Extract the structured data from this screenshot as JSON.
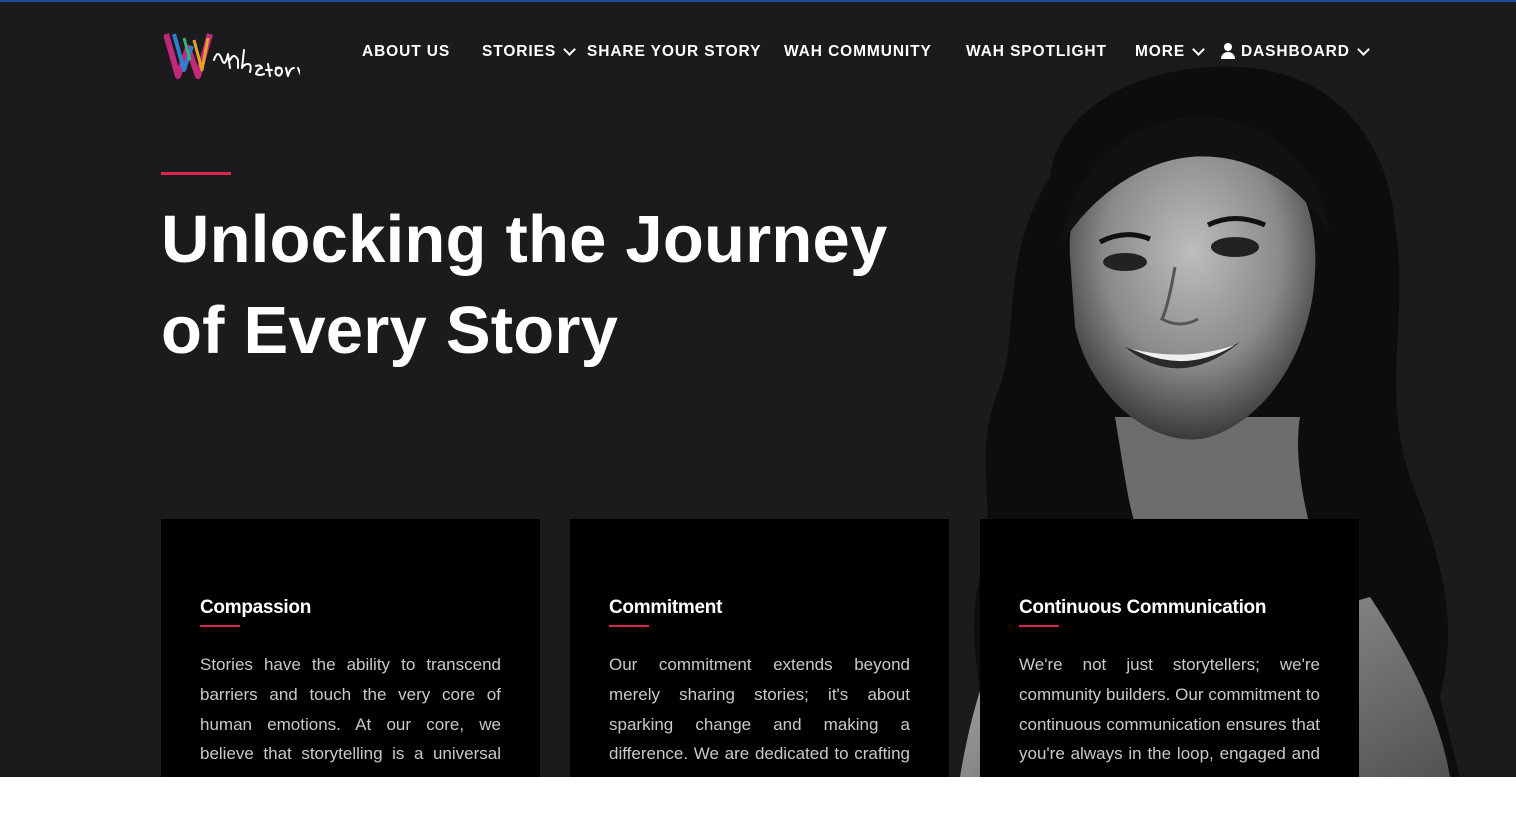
{
  "brand": {
    "logo_alt": "Wahstory"
  },
  "nav": {
    "items": [
      {
        "label": "ABOUT US",
        "has_dropdown": false
      },
      {
        "label": "STORIES",
        "has_dropdown": true
      },
      {
        "label": "SHARE YOUR STORY",
        "has_dropdown": false
      },
      {
        "label": "WAH COMMUNITY",
        "has_dropdown": false
      },
      {
        "label": "WAH SPOTLIGHT",
        "has_dropdown": false
      },
      {
        "label": "MORE",
        "has_dropdown": true
      },
      {
        "label": "DASHBOARD",
        "has_dropdown": true,
        "icon": "user-icon"
      }
    ]
  },
  "hero": {
    "headline_line1": "Unlocking the Journey",
    "headline_line2": "of Every Story",
    "accent_color": "#d8264f"
  },
  "cards": [
    {
      "title": "Compassion",
      "text": "Stories have the ability to transcend barriers and touch the very core of human emotions. At our core, we believe that storytelling is a universal language that unites us all. Through"
    },
    {
      "title": "Commitment",
      "text": "Our commitment extends beyond merely sharing stories; it's about sparking change and making a difference. We are dedicated to crafting narratives that ignite curiosity"
    },
    {
      "title": "Continuous Communication",
      "text": "We're not just storytellers; we're community builders. Our commitment to continuous communication ensures that you're always in the loop, engaged and connected with our"
    }
  ],
  "colors": {
    "background": "#1b1a1c",
    "card": "#000000",
    "accent": "#d8264f",
    "topline": "#1d4f9c"
  }
}
